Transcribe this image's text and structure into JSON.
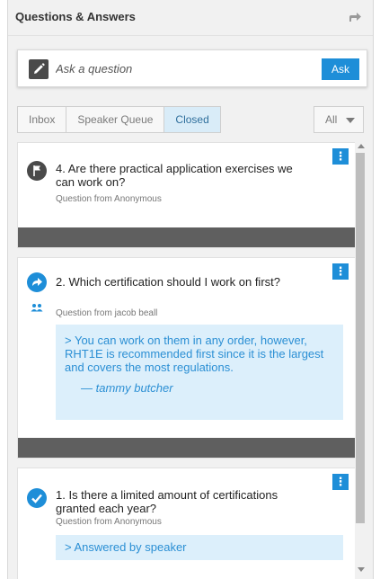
{
  "header": {
    "title": "Questions & Answers",
    "share_icon": "share-icon"
  },
  "ask": {
    "placeholder": "Ask a question",
    "button_label": "Ask",
    "pencil_icon": "pencil-icon"
  },
  "tabs": [
    {
      "label": "Inbox",
      "active": false
    },
    {
      "label": "Speaker Queue",
      "active": false
    },
    {
      "label": "Closed",
      "active": true
    }
  ],
  "filter": {
    "label": "All"
  },
  "colors": {
    "accent": "#1e8ed8",
    "answer_bg": "#dceffb",
    "answer_text": "#2b8fd4",
    "card_footer": "#5f5f5f"
  },
  "questions": [
    {
      "status_icon": "flag-icon",
      "text": "4. Are there practical application exercises we can work on?",
      "from": "Question from Anonymous",
      "menu": "⋮"
    },
    {
      "status_icon": "forward-arrow-icon",
      "text": "2. Which certification should I work on first?",
      "from": "Question from jacob beall",
      "menu": "⋮",
      "answer": "> You can work on them in any order, however, RHT1E is recommended first since it is the largest and covers the most regulations.",
      "answer_author": "— tammy butcher"
    },
    {
      "status_icon": "check-circle-icon",
      "text": "1. Is there a limited amount of certifications granted each year?",
      "from": "Question from Anonymous",
      "menu": "⋮",
      "answer": "> Answered by speaker"
    }
  ]
}
